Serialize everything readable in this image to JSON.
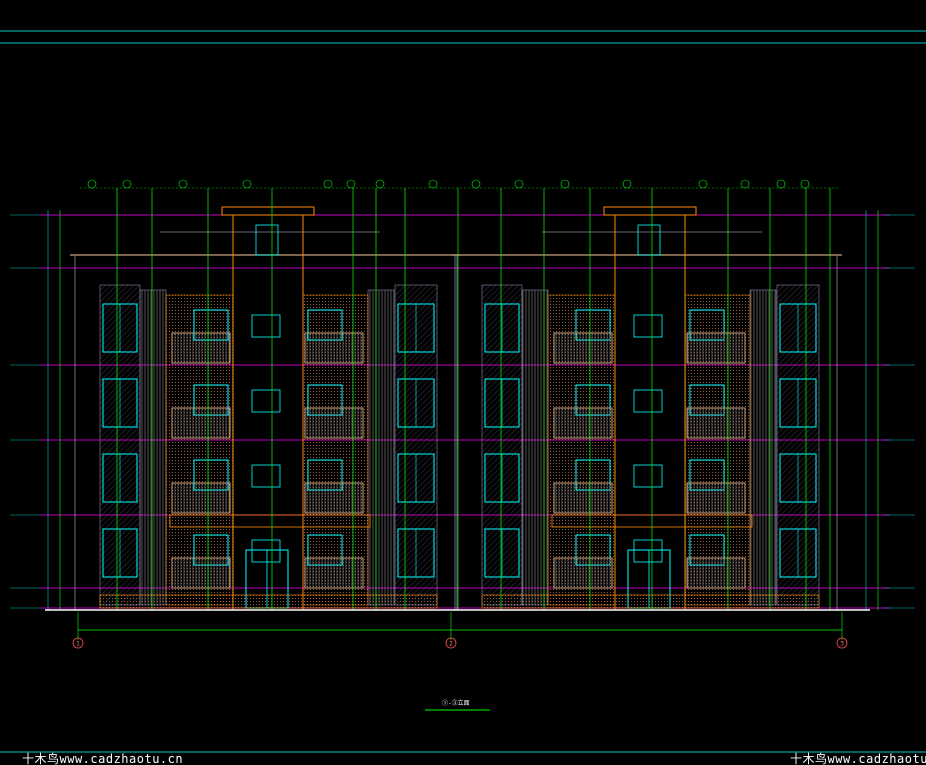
{
  "drawing": {
    "title": "①-③立面",
    "colors": {
      "background": "#000000",
      "frame": "#00c8c8",
      "axis": "#00ff00",
      "level": "#ff00ff",
      "outline": "#ff8c00",
      "window": "#00ffff",
      "wall": "#8888aa",
      "balcony": "#c8a078",
      "text": "#ffffff"
    },
    "axis_labels": [
      "1",
      "2",
      "3"
    ]
  },
  "watermark": {
    "left": "十木鸟www.cadzhaotu.cn",
    "right": "十木鸟www.cadzhaotu."
  }
}
